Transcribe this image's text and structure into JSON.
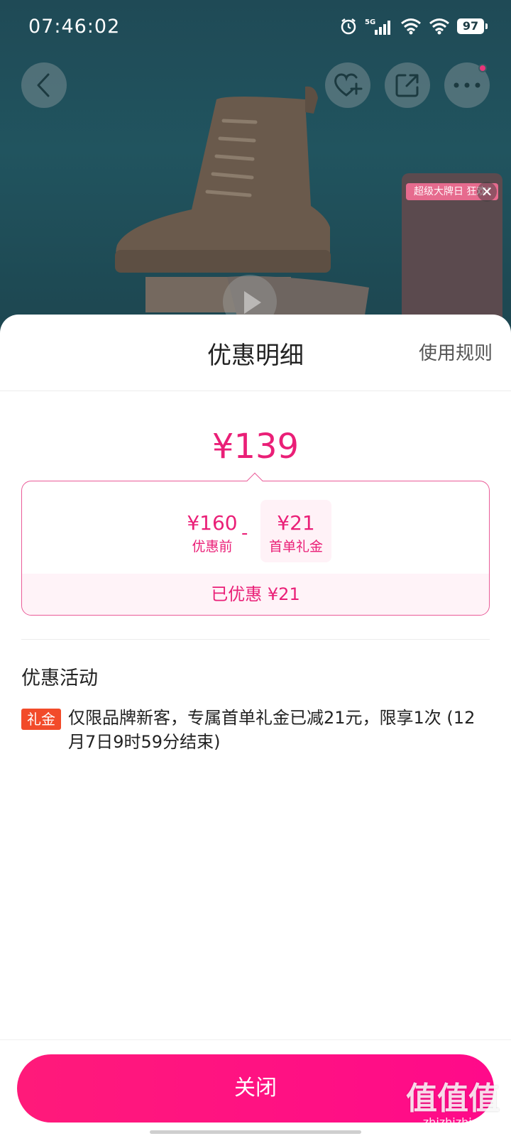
{
  "status_bar": {
    "time": "07:46:02",
    "network": "5G",
    "battery": "97",
    "icons": [
      "alarm-icon",
      "signal-icon",
      "wifi-icon",
      "wifi-icon",
      "battery-icon"
    ]
  },
  "product_area": {
    "mini_video_banner": "超级大牌日 狂欢!",
    "mini_video_close": "✕"
  },
  "sheet": {
    "title": "优惠明细",
    "rules_link": "使用规则",
    "final_price": "¥139",
    "breakdown": {
      "original_amount": "¥160",
      "original_label": "优惠前",
      "minus_sign": "-",
      "gift_amount": "¥21",
      "gift_label": "首单礼金",
      "saved_text": "已优惠 ¥21"
    },
    "promotions": {
      "heading": "优惠活动",
      "items": [
        {
          "badge": "礼金",
          "text": "仅限品牌新客，专属首单礼金已减21元，限享1次 (12月7日9时59分结束)"
        }
      ]
    },
    "close_button": "关闭"
  },
  "watermark": {
    "main": "值值值",
    "sub": "zhizhizhi.com"
  },
  "colors": {
    "accent": "#ea1f77",
    "button": "#ff1a7a",
    "badge": "#f24b2a"
  }
}
